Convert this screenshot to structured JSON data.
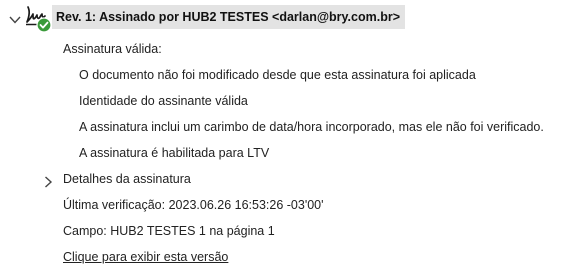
{
  "signature": {
    "header": "Rev. 1: Assinado por HUB2 TESTES <darlan@bry.com.br>",
    "validity_label": "Assinatura válida:",
    "details": [
      "O documento não foi modificado desde que esta assinatura foi aplicada",
      "Identidade do assinante válida",
      "A assinatura inclui um carimbo de data/hora incorporado, mas ele não foi verificado.",
      "A assinatura é habilitada para LTV"
    ],
    "signature_details_label": "Detalhes da assinatura",
    "last_verification": "Última verificação: 2023.06.26 16:53:26 -03'00'",
    "field": "Campo: HUB2 TESTES 1 na página 1",
    "view_version_link": "Clique para exibir esta versão"
  },
  "icons": {
    "expand": "chevron-down-icon",
    "signature": "signature-pen-icon",
    "valid": "green-check-icon",
    "collapse": "chevron-right-icon"
  },
  "colors": {
    "header_bg": "#e3e3e3",
    "valid_green": "#3a9a3a"
  }
}
